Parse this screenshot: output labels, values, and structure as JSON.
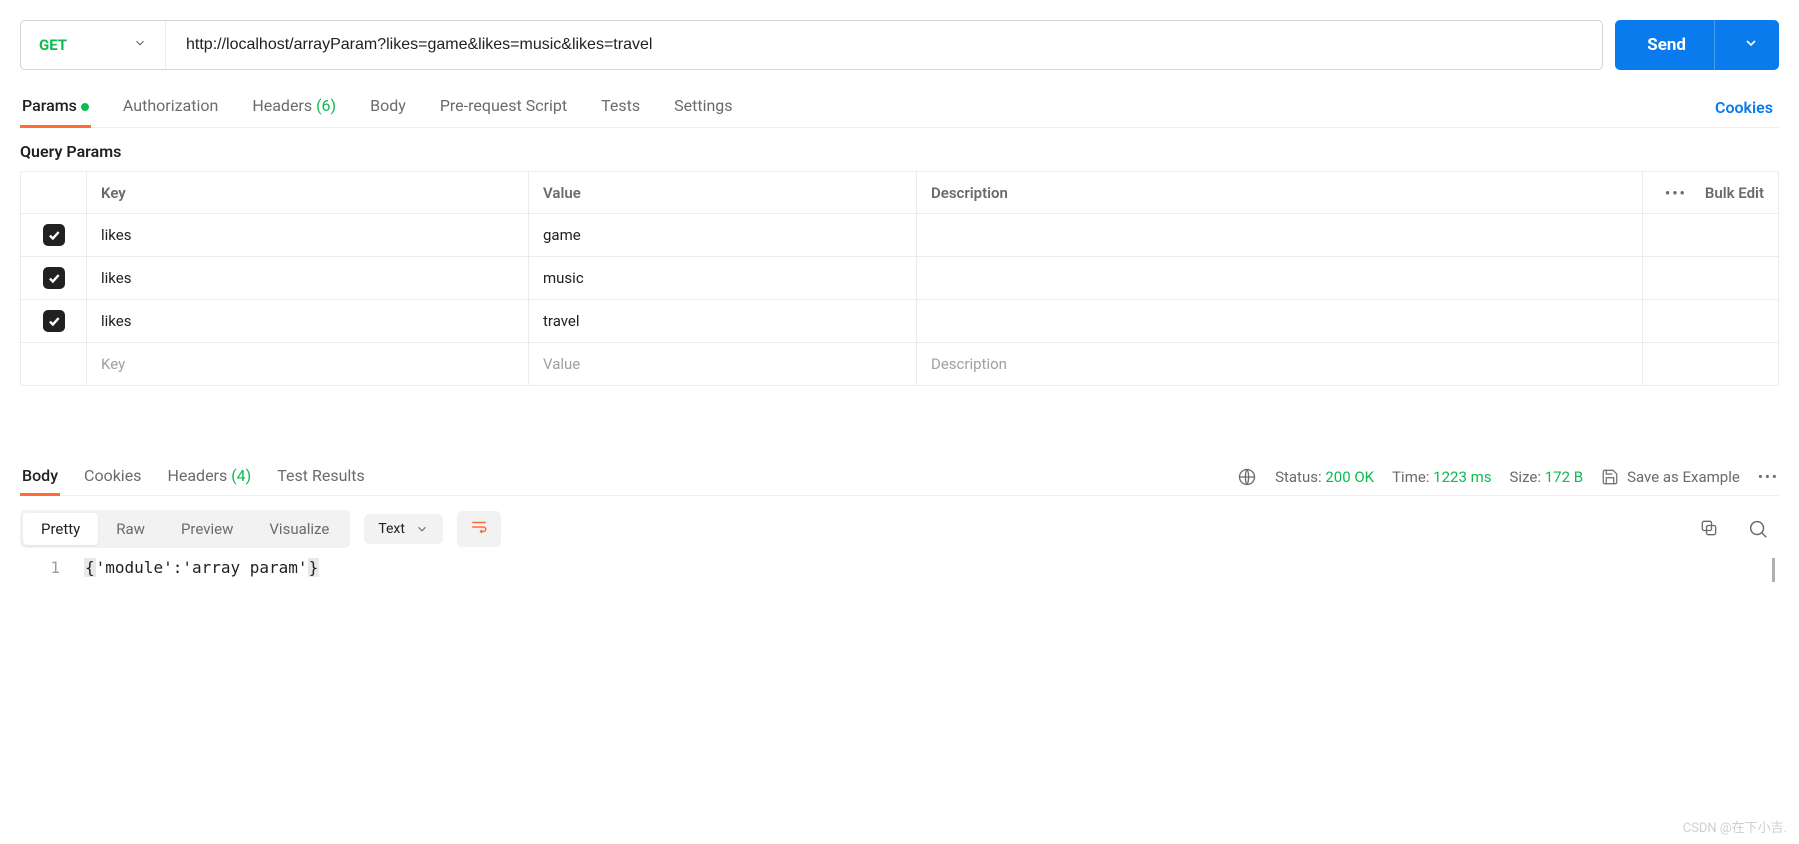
{
  "request": {
    "method": "GET",
    "url": "http://localhost/arrayParam?likes=game&likes=music&likes=travel",
    "send_label": "Send"
  },
  "req_tabs": {
    "params": "Params",
    "authorization": "Authorization",
    "headers": "Headers",
    "headers_count": "(6)",
    "body": "Body",
    "prerequest": "Pre-request Script",
    "tests": "Tests",
    "settings": "Settings",
    "cookies": "Cookies"
  },
  "query_section_title": "Query Params",
  "table": {
    "header": {
      "key": "Key",
      "value": "Value",
      "description": "Description",
      "more": "•••",
      "bulk": "Bulk Edit"
    },
    "rows": [
      {
        "key": "likes",
        "value": "game",
        "description": ""
      },
      {
        "key": "likes",
        "value": "music",
        "description": ""
      },
      {
        "key": "likes",
        "value": "travel",
        "description": ""
      }
    ],
    "placeholder": {
      "key": "Key",
      "value": "Value",
      "description": "Description"
    }
  },
  "resp_tabs": {
    "body": "Body",
    "cookies": "Cookies",
    "headers": "Headers",
    "headers_count": "(4)",
    "test_results": "Test Results"
  },
  "status": {
    "status_label": "Status:",
    "status_value": "200 OK",
    "time_label": "Time:",
    "time_value": "1223 ms",
    "size_label": "Size:",
    "size_value": "172 B",
    "save_example": "Save as Example"
  },
  "view": {
    "pretty": "Pretty",
    "raw": "Raw",
    "preview": "Preview",
    "visualize": "Visualize",
    "type": "Text"
  },
  "response_body": {
    "line1_no": "1",
    "line1_text": "'module':'array param'"
  },
  "watermark": "CSDN @在下小吉."
}
